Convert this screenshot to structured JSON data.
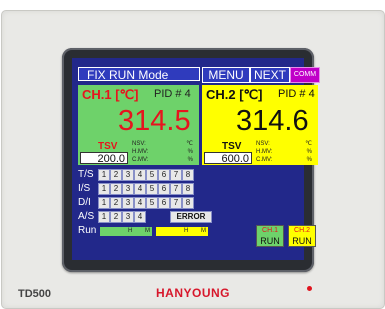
{
  "model": "TD500",
  "brand": "HANYOUNG",
  "header": {
    "title": "FIX RUN Mode",
    "menu": "MENU",
    "next": "NEXT",
    "comm": "COMM"
  },
  "ch1": {
    "label": "CH.1 [℃]",
    "pid": "PID # 4",
    "pv": "314.5",
    "tsv_label": "TSV",
    "sv": "200.0",
    "nsv": "NSV:",
    "hmv": "H.MV:",
    "cmv": "C.MV:",
    "unit_c": "℃",
    "pct1": "%",
    "pct2": "%"
  },
  "ch2": {
    "label": "CH.2 [℃]",
    "pid": "PID # 4",
    "pv": "314.6",
    "tsv_label": "TSV",
    "sv": "600.0",
    "nsv": "NSV:",
    "hmv": "H.MV:",
    "cmv": "C.MV:",
    "unit_c": "℃",
    "pct1": "%",
    "pct2": "%"
  },
  "grid": [
    {
      "label": "T/S",
      "cells": [
        "1",
        "2",
        "3",
        "4",
        "5",
        "6",
        "7",
        "8"
      ]
    },
    {
      "label": "I/S",
      "cells": [
        "1",
        "2",
        "3",
        "4",
        "5",
        "6",
        "7",
        "8"
      ]
    },
    {
      "label": "D/I",
      "cells": [
        "1",
        "2",
        "3",
        "4",
        "5",
        "6",
        "7",
        "8"
      ]
    },
    {
      "label": "A/S",
      "cells": [
        "1",
        "2",
        "3",
        "4"
      ]
    }
  ],
  "error_label": "ERROR",
  "run": {
    "label": "Run",
    "bar1_h": "H",
    "bar1_m": "M",
    "bar2_h": "H",
    "bar2_m": "M"
  },
  "run_buttons": [
    {
      "top": "CH.1",
      "bottom": "RUN"
    },
    {
      "top": "CH.2",
      "bottom": "RUN"
    }
  ],
  "colors": {
    "screen": "#22288a",
    "ch1": "#6ed26a",
    "ch2": "#ffff00",
    "accent": "#e6141e",
    "comm": "#c000c8"
  }
}
